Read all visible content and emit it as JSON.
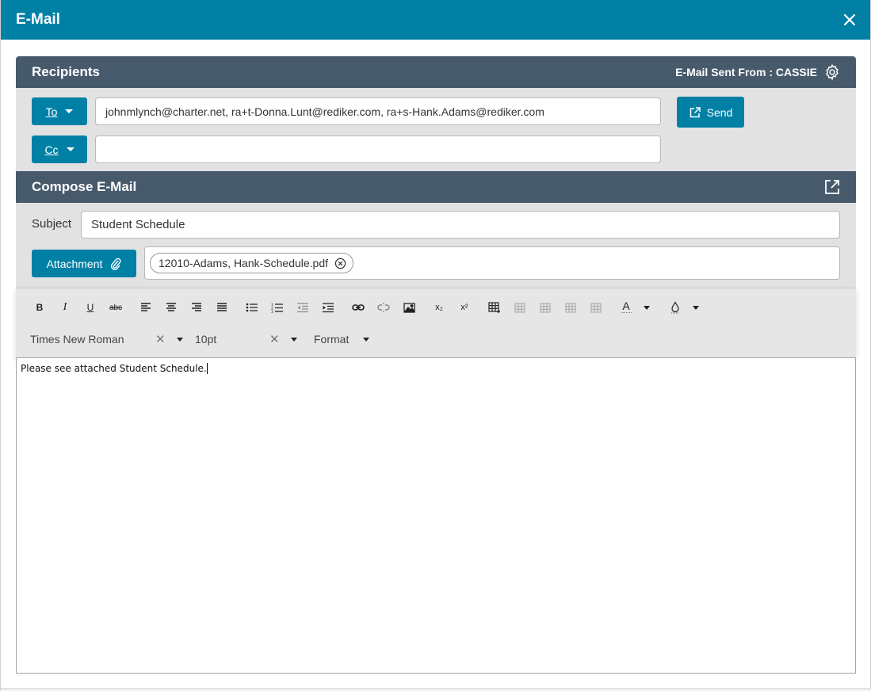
{
  "window": {
    "title": "E-Mail"
  },
  "recipients": {
    "header": "Recipients",
    "sent_from": "E-Mail Sent From : CASSIE",
    "to_label": "To",
    "cc_label": "Cc",
    "to_value": "johnmlynch@charter.net, ra+t-Donna.Lunt@rediker.com, ra+s-Hank.Adams@rediker.com",
    "cc_value": "",
    "send_label": "Send"
  },
  "compose": {
    "header": "Compose E-Mail",
    "subject_label": "Subject",
    "subject_value": "Student Schedule",
    "attachment_label": "Attachment",
    "attachment_file": "12010-Adams, Hank-Schedule.pdf"
  },
  "toolbar": {
    "bold": "B",
    "italic": "I",
    "underline": "U",
    "strike": "abc",
    "subscript": "x₂",
    "superscript": "x²",
    "font_color": "A",
    "font_family": "Times New Roman",
    "font_size": "10pt",
    "format": "Format"
  },
  "editor": {
    "body": "Please see attached Student Schedule."
  },
  "colors": {
    "titlebar": "#0180a6",
    "section_header": "#475a6c",
    "button": "#0180a6"
  }
}
